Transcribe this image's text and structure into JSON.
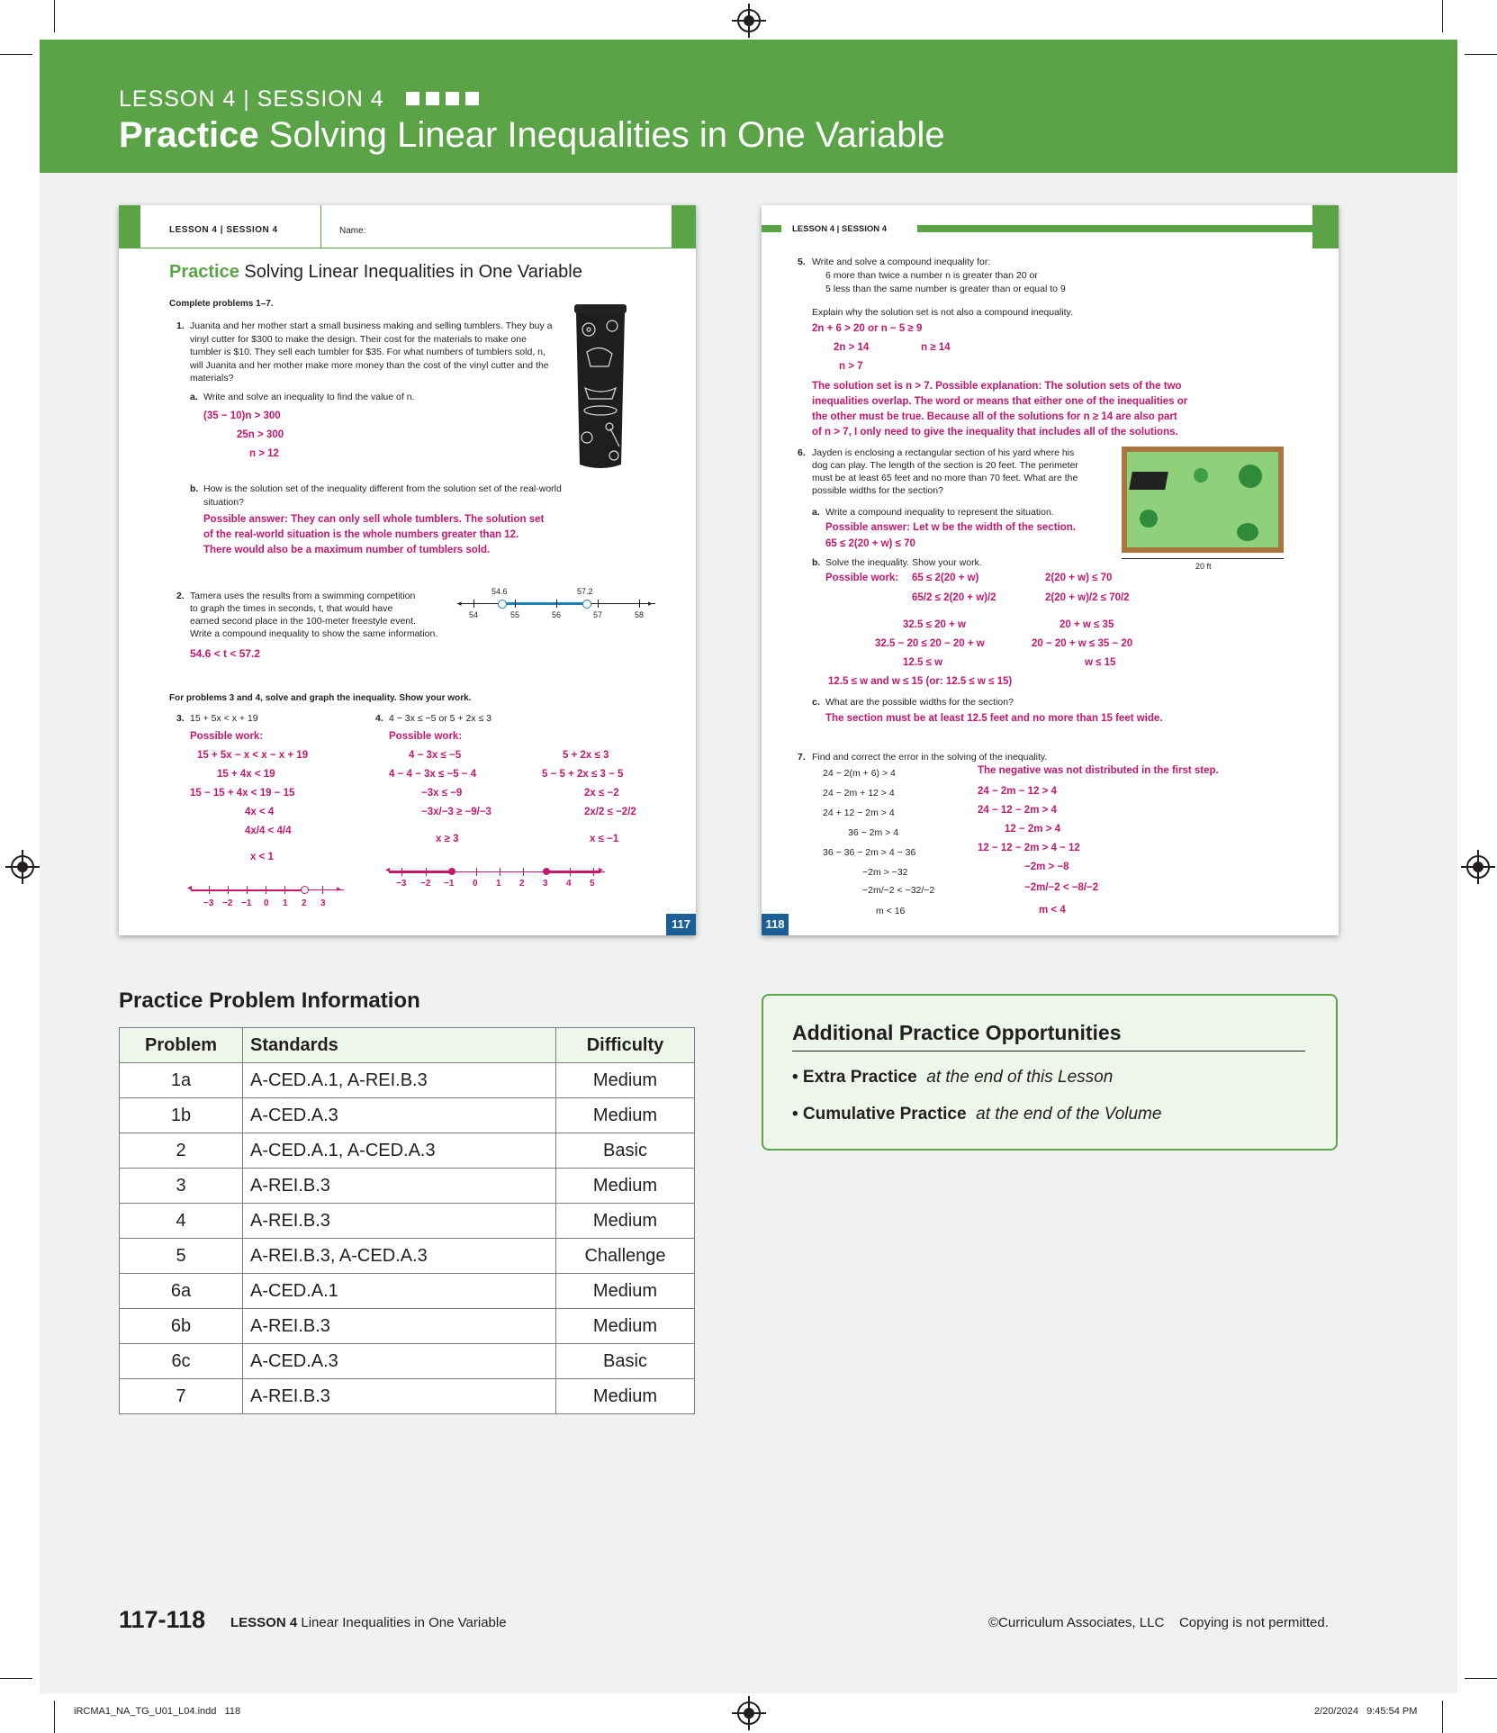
{
  "banner": {
    "lesson_session": "LESSON 4 | SESSION 4",
    "title_bold": "Practice",
    "title_rest": "Solving Linear Inequalities in One Variable"
  },
  "left_page": {
    "header": "LESSON 4 | SESSION 4",
    "name_label": "Name:",
    "title_bold": "Practice",
    "title_rest": "Solving Linear Inequalities in One Variable",
    "instructions": "Complete problems 1–7.",
    "p1": {
      "num": "1.",
      "text": "Juanita and her mother start a small business making and selling tumblers. They buy a vinyl cutter for $300 to make the design. Their cost for the materials to make one tumbler is $10. They sell each tumbler for $35. For what numbers of tumblers sold, n, will Juanita and her mother make more money than the cost of the vinyl cutter and the materials?",
      "a_label": "a.",
      "a_text": "Write and solve an inequality to find the value of n.",
      "a_work": [
        "(35 − 10)n > 300",
        "25n > 300",
        "n > 12"
      ],
      "b_label": "b.",
      "b_text": "How is the solution set of the inequality different from the solution set of the real-world situation?",
      "b_answer": [
        "Possible answer: They can only sell whole tumblers. The solution set",
        "of the real-world situation is the whole numbers greater than 12.",
        "There would also be a maximum number of tumblers sold."
      ]
    },
    "p2": {
      "num": "2.",
      "text": [
        "Tamera uses the results from a swimming competition",
        "to graph the times in seconds, t, that would have",
        "earned second place in the 100-meter freestyle event.",
        "Write a compound inequality to show the same information."
      ],
      "answer": "54.6 < t < 57.2",
      "numberline": {
        "ticks": [
          "54",
          "55",
          "56",
          "57",
          "58"
        ],
        "labels": [
          "54.6",
          "57.2"
        ]
      }
    },
    "p34_instructions": "For problems 3 and 4, solve and graph the inequality. Show your work.",
    "p3": {
      "num": "3.",
      "problem": "15 + 5x < x + 19",
      "work_label": "Possible work:",
      "work": [
        "15 + 5x − x < x − x + 19",
        "15 + 4x < 19",
        "15 − 15 + 4x < 19 − 15",
        "4x < 4",
        "4x/4 < 4/4",
        "x < 1"
      ],
      "ticks": [
        "−3",
        "−2",
        "−1",
        "0",
        "1",
        "2",
        "3"
      ]
    },
    "p4": {
      "num": "4.",
      "problem": "4 − 3x ≤ −5 or 5 + 2x ≤ 3",
      "work_label": "Possible work:",
      "work_left": [
        "4 − 3x ≤ −5",
        "4 − 4 − 3x ≤ −5 − 4",
        "−3x ≤ −9",
        "−3x/−3 ≥ −9/−3",
        "x ≥ 3"
      ],
      "work_right": [
        "5 + 2x ≤ 3",
        "5 − 5 + 2x ≤ 3 − 5",
        "2x ≤ −2",
        "2x/2 ≤ −2/2",
        "x ≤ −1"
      ],
      "ticks": [
        "−3",
        "−2",
        "−1",
        "0",
        "1",
        "2",
        "3",
        "4",
        "5"
      ]
    },
    "page_num": "117"
  },
  "right_page": {
    "header": "LESSON 4 | SESSION 4",
    "p5": {
      "num": "5.",
      "text": "Write and solve a compound inequality for:",
      "lines": [
        "6 more than twice a number n is greater than 20 or",
        "5 less than the same number is greater than or equal to 9"
      ],
      "explain": "Explain why the solution set is not also a compound inequality.",
      "work": [
        "2n + 6 > 20  or  n − 5 ≥ 9",
        "2n > 14",
        "n ≥ 14",
        "n > 7"
      ],
      "answer": [
        "The solution set is n > 7. Possible explanation: The solution sets of the two",
        "inequalities overlap. The word or means that either one of the inequalities or",
        "the other must be true. Because all of the solutions for n ≥ 14 are also part",
        "of n > 7, I only need to give the inequality that includes all of the solutions."
      ]
    },
    "p6": {
      "num": "6.",
      "text": [
        "Jayden is enclosing a rectangular section of his yard where his",
        "dog can play. The length of the section is 20 feet. The perimeter",
        "must be at least 65 feet and no more than 70 feet. What are the",
        "possible widths for the section?"
      ],
      "a_label": "a.",
      "a_text": "Write a compound inequality to represent the situation.",
      "a_answer": [
        "Possible answer: Let w be the width of the section.",
        "65 ≤ 2(20 + w) ≤ 70"
      ],
      "b_label": "b.",
      "b_text": "Solve the inequality. Show your work.",
      "b_work_label": "Possible work:",
      "b_left": [
        "65 ≤ 2(20 + w)",
        "65/2 ≤ 2(20 + w)/2",
        "32.5 ≤ 20 + w",
        "32.5 − 20 ≤ 20 − 20 + w",
        "12.5 ≤ w"
      ],
      "b_right": [
        "2(20 + w) ≤ 70",
        "2(20 + w)/2 ≤ 70/2",
        "20 + w ≤ 35",
        "20 − 20 + w ≤ 35 − 20",
        "w ≤ 15"
      ],
      "b_final": "12.5 ≤ w and w ≤ 15 (or: 12.5 ≤ w ≤ 15)",
      "c_label": "c.",
      "c_text": "What are the possible widths for the section?",
      "c_answer": "The section must be at least 12.5 feet and no more than 15 feet wide.",
      "yard_label": "20 ft"
    },
    "p7": {
      "num": "7.",
      "text": "Find and correct the error in the solving of the inequality.",
      "error_work": [
        "24 − 2(m + 6) > 4",
        "24 − 2m + 12 > 4",
        "24 + 12 − 2m > 4",
        "36 − 2m > 4",
        "36 − 36 − 2m > 4 − 36",
        "−2m > −32",
        "−2m/−2 < −32/−2",
        "m < 16"
      ],
      "explanation": "The negative was not distributed in the first step.",
      "correct_work": [
        "24 − 2m − 12 > 4",
        "24 − 12 − 2m > 4",
        "12 − 2m > 4",
        "12 − 12 − 2m > 4 − 12",
        "−2m > −8",
        "−2m/−2 < −8/−2",
        "m < 4"
      ]
    },
    "page_num": "118"
  },
  "info_table": {
    "heading": "Practice Problem Information",
    "columns": [
      "Problem",
      "Standards",
      "Difficulty"
    ],
    "rows": [
      [
        "1a",
        "A-CED.A.1, A-REI.B.3",
        "Medium"
      ],
      [
        "1b",
        "A-CED.A.3",
        "Medium"
      ],
      [
        "2",
        "A-CED.A.1, A-CED.A.3",
        "Basic"
      ],
      [
        "3",
        "A-REI.B.3",
        "Medium"
      ],
      [
        "4",
        "A-REI.B.3",
        "Medium"
      ],
      [
        "5",
        "A-REI.B.3, A-CED.A.3",
        "Challenge"
      ],
      [
        "6a",
        "A-CED.A.1",
        "Medium"
      ],
      [
        "6b",
        "A-REI.B.3",
        "Medium"
      ],
      [
        "6c",
        "A-CED.A.3",
        "Basic"
      ],
      [
        "7",
        "A-REI.B.3",
        "Medium"
      ]
    ]
  },
  "additional": {
    "heading": "Additional Practice Opportunities",
    "items": [
      {
        "bold": "• Extra Practice",
        "italic": "at the end of this Lesson"
      },
      {
        "bold": "• Cumulative Practice",
        "italic": "at the end of the Volume"
      }
    ]
  },
  "footer": {
    "pages": "117-118",
    "lesson": "LESSON 4",
    "lesson_title": "Linear Inequalities in One Variable",
    "copyright": "©Curriculum Associates, LLC    Copying is not permitted."
  },
  "slug": {
    "file": "iRCMA1_NA_TG_U01_L04.indd   118",
    "timestamp": "2/20/2024   9:45:54 PM"
  },
  "colors": {
    "green": "#5aa346",
    "magenta": "#c4186c",
    "blue": "#1c5e96"
  }
}
